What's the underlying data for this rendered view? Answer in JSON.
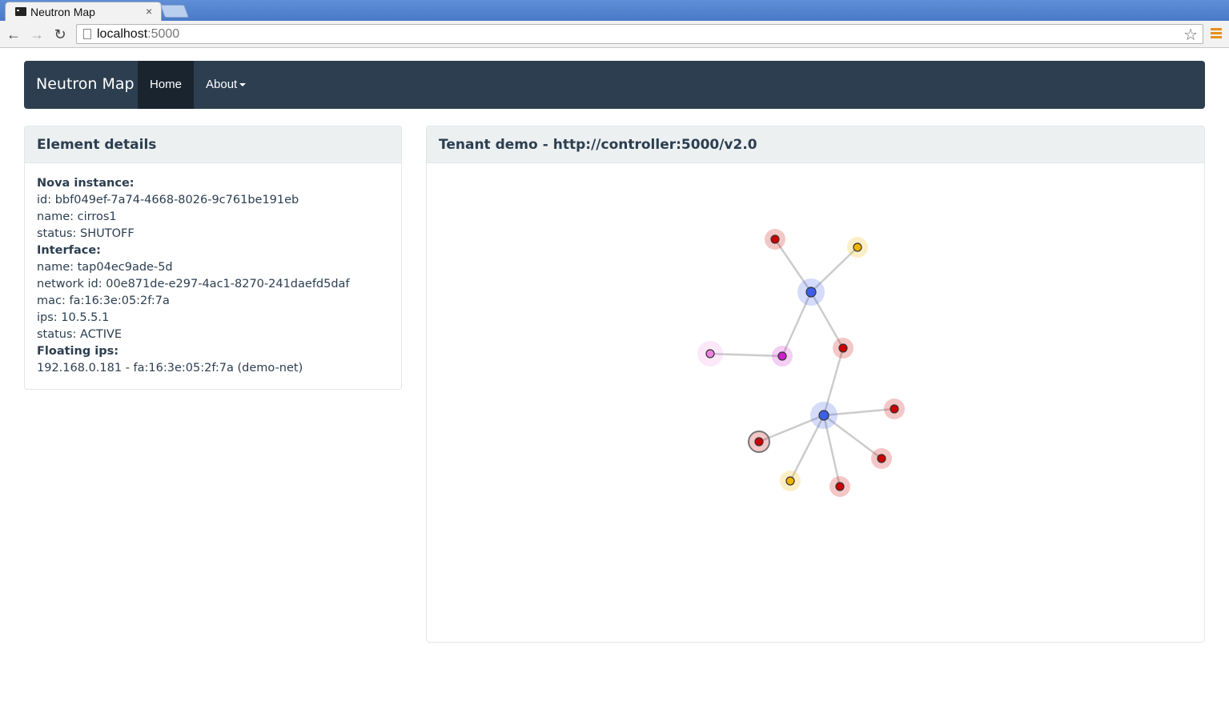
{
  "browser": {
    "tab_title": "Neutron Map",
    "tab_close": "×",
    "url_host": "localhost",
    "url_port": ":5000",
    "back": "←",
    "forward": "→",
    "reload": "↻",
    "star": "☆"
  },
  "navbar": {
    "brand": "Neutron Map",
    "home": "Home",
    "about": "About"
  },
  "details": {
    "title": "Element details",
    "lines": [
      {
        "text": "Nova instance:",
        "head": true
      },
      {
        "text": "id: bbf049ef-7a74-4668-8026-9c761be191eb",
        "head": false
      },
      {
        "text": "name: cirros1",
        "head": false
      },
      {
        "text": "status: SHUTOFF",
        "head": false
      },
      {
        "text": "Interface:",
        "head": true
      },
      {
        "text": "name: tap04ec9ade-5d",
        "head": false
      },
      {
        "text": "network id: 00e871de-e297-4ac1-8270-241daefd5daf",
        "head": false
      },
      {
        "text": "mac: fa:16:3e:05:2f:7a",
        "head": false
      },
      {
        "text": "ips: 10.5.5.1",
        "head": false
      },
      {
        "text": "status: ACTIVE",
        "head": false
      },
      {
        "text": "Floating ips:",
        "head": true
      },
      {
        "text": "192.168.0.181 - fa:16:3e:05:2f:7a (demo-net)",
        "head": false
      }
    ]
  },
  "map": {
    "tenant_label": "Tenant demo",
    "separator": "-",
    "endpoint": "http://controller:5000/v2.0",
    "colors": {
      "network": "#3d5fe8",
      "instance": "#cc0000",
      "router": "#cc22cc",
      "external": "#f080e0",
      "port": "#f0b400",
      "link": "#cccccc"
    },
    "node_types": [
      "network",
      "network",
      "instance",
      "port",
      "instance",
      "router",
      "external",
      "instance",
      "instance",
      "instance",
      "port",
      "instance"
    ],
    "edges": [
      [
        0,
        2
      ],
      [
        0,
        3
      ],
      [
        0,
        4
      ],
      [
        0,
        5
      ],
      [
        5,
        6
      ],
      [
        4,
        1
      ],
      [
        1,
        7
      ],
      [
        1,
        8
      ],
      [
        1,
        9
      ],
      [
        1,
        10
      ],
      [
        1,
        11
      ]
    ],
    "selected_node": 8
  }
}
